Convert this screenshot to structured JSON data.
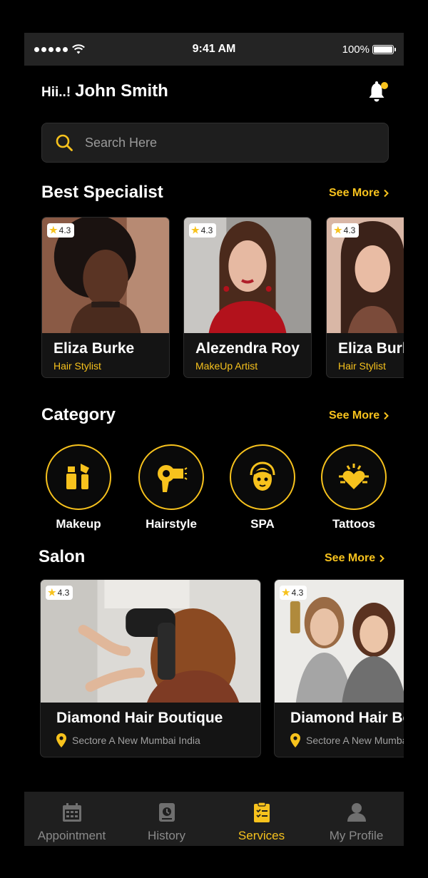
{
  "status_bar": {
    "time": "9:41 AM",
    "battery": "100%"
  },
  "header": {
    "greeting": "Hii..!",
    "user_name": "John Smith"
  },
  "search": {
    "placeholder": "Search Here"
  },
  "best_specialist": {
    "title": "Best Specialist",
    "see_more": "See More",
    "items": [
      {
        "rating": "4.3",
        "name": "Eliza Burke",
        "role": "Hair Stylist"
      },
      {
        "rating": "4.3",
        "name": "Alezendra Roy",
        "role": "MakeUp Artist"
      },
      {
        "rating": "4.3",
        "name": "Eliza Burke",
        "role": "Hair Stylist"
      }
    ]
  },
  "category": {
    "title": "Category",
    "see_more": "See More",
    "items": [
      {
        "label": "Makeup",
        "icon": "makeup-icon"
      },
      {
        "label": "Hairstyle",
        "icon": "hairdryer-icon"
      },
      {
        "label": "SPA",
        "icon": "spa-face-icon"
      },
      {
        "label": "Tattoos",
        "icon": "tattoo-heart-icon"
      }
    ]
  },
  "salon": {
    "title": "Salon",
    "see_more": "See More",
    "items": [
      {
        "rating": "4.3",
        "name": "Diamond Hair Boutique",
        "location": "Sectore A New Mumbai India"
      },
      {
        "rating": "4.3",
        "name": "Diamond Hair Boutique",
        "location": "Sectore A New Mumbai India"
      }
    ]
  },
  "tab_bar": {
    "items": [
      {
        "label": "Appointment",
        "icon": "calendar-icon"
      },
      {
        "label": "History",
        "icon": "history-book-icon"
      },
      {
        "label": "Services",
        "icon": "clipboard-check-icon",
        "active": true
      },
      {
        "label": "My Profile",
        "icon": "user-icon"
      }
    ]
  },
  "colors": {
    "accent": "#f7c21d",
    "background": "#000000",
    "card": "#141414",
    "status_bar": "#242424",
    "tab_bar": "#1f1f1f"
  }
}
